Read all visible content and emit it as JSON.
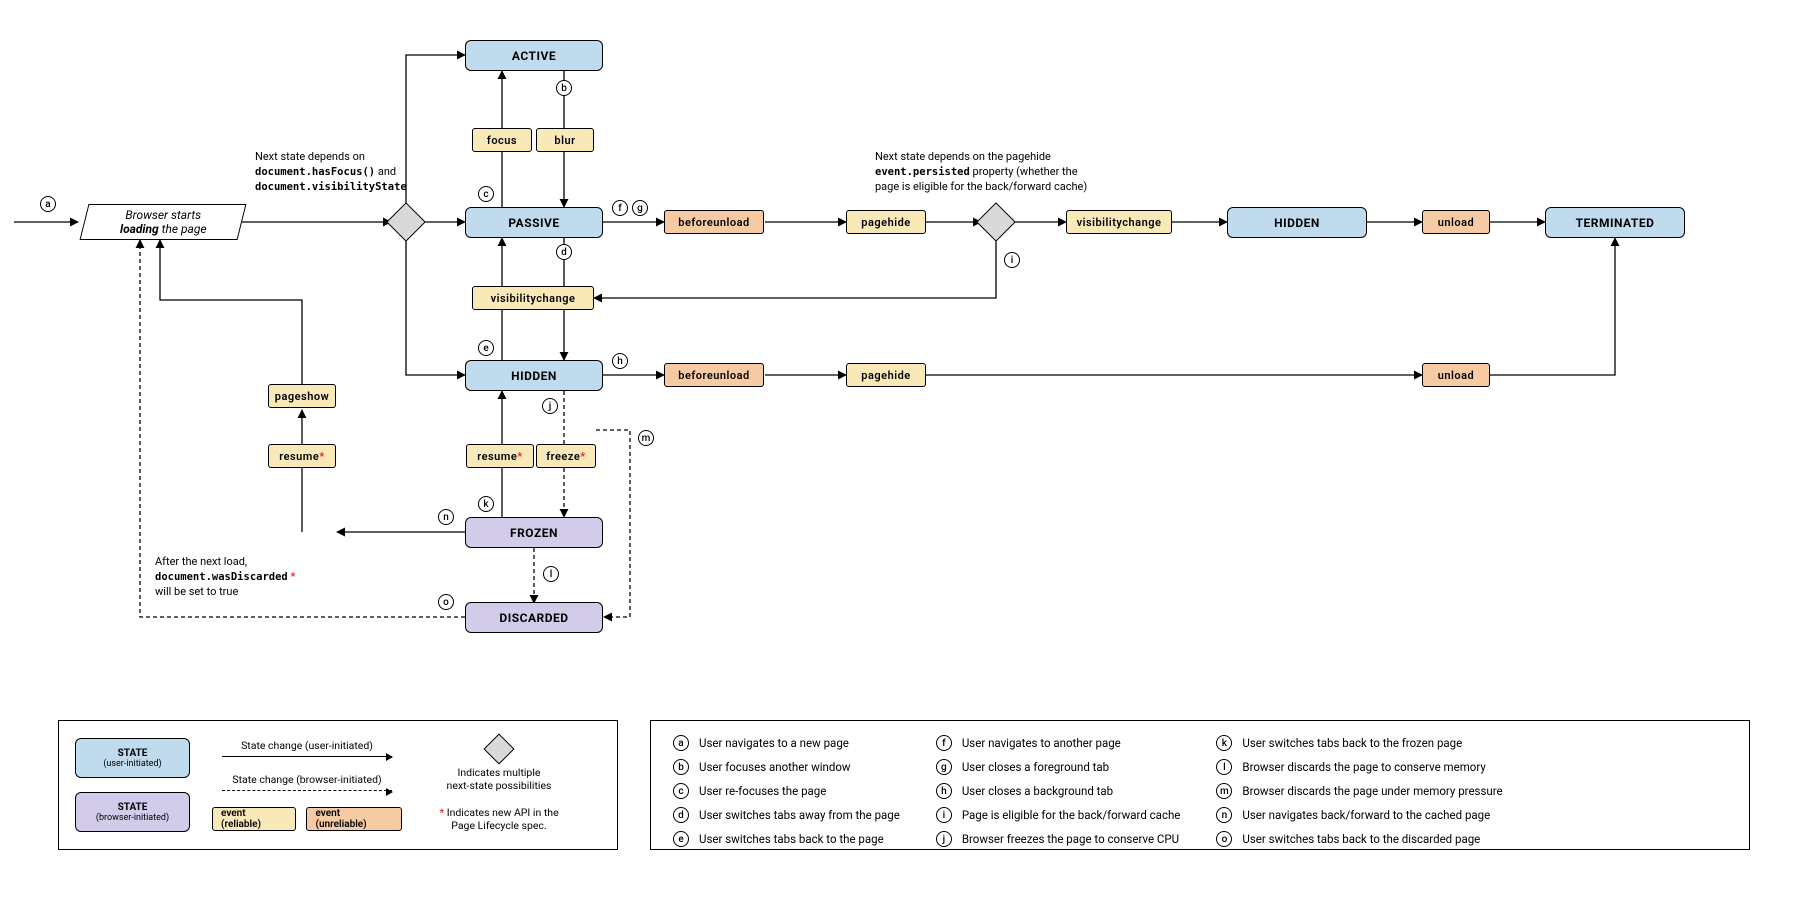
{
  "loader_html": "Browser starts<br><b>loading</b> the page",
  "states": {
    "active": "ACTIVE",
    "passive": "PASSIVE",
    "hidden": "HIDDEN",
    "hidden2": "HIDDEN",
    "frozen": "FROZEN",
    "discarded": "DISCARDED",
    "terminated": "TERMINATED"
  },
  "events": {
    "focus": "focus",
    "blur": "blur",
    "vc_passive": "visibilitychange",
    "resume_p": "resume",
    "freeze": "freeze",
    "bunload1": "beforeunload",
    "phide1": "pagehide",
    "vc_after_hide": "visibilitychange",
    "unload1": "unload",
    "bunload2": "beforeunload",
    "phide2": "pagehide",
    "unload2": "unload",
    "resume_left": "resume",
    "pageshow": "pageshow"
  },
  "annotations": {
    "has_focus_pre": "Next state depends on",
    "has_focus_c1": "document.hasFocus()",
    "has_focus_mid": " and",
    "has_focus_c2": "document.visibilityState",
    "persisted": "Next state depends on the pagehide <br><code>event.persisted</code> property (whether the <br>page is eligible for the back/forward cache)",
    "was_discarded_pre": "After the next load,",
    "was_discarded_code": "document.wasDiscarded",
    "was_discarded_post": "will be set to true"
  },
  "markers": {
    "a": "a",
    "b": "b",
    "c": "c",
    "d": "d",
    "e": "e",
    "f": "f",
    "g": "g",
    "h": "h",
    "i": "i",
    "j": "j",
    "k": "k",
    "l": "l",
    "m": "m",
    "n": "n",
    "o": "o"
  },
  "legend": {
    "state_label": "STATE",
    "user_init": "(user-initiated)",
    "browser_init": "(browser-initiated)",
    "arrow_user": "State change (user-initiated)",
    "arrow_browser": "State change (browser-initiated)",
    "ev_rel": "event (reliable)",
    "ev_unrel": "event (unreliable)",
    "diamond_l1": "Indicates multiple",
    "diamond_l2": "next-state possibilities",
    "star_l1": "Indicates new API in the",
    "star_l2": "Page Lifecycle spec."
  },
  "glossary": {
    "a": "User navigates to a new page",
    "b": "User focuses another window",
    "c": "User re-focuses the page",
    "d": "User switches tabs away from the page",
    "e": "User switches tabs back to the page",
    "f": "User navigates to another page",
    "g": "User closes a foreground tab",
    "h": "User closes a background tab",
    "i": "Page is eligible for the back/forward cache",
    "j": "Browser freezes the page to conserve CPU",
    "k": "User switches tabs back to the frozen page",
    "l": "Browser discards the page to conserve memory",
    "m": "Browser discards the page under memory pressure",
    "n": "User navigates back/forward to the cached page",
    "o": "User switches tabs back to the discarded page"
  }
}
